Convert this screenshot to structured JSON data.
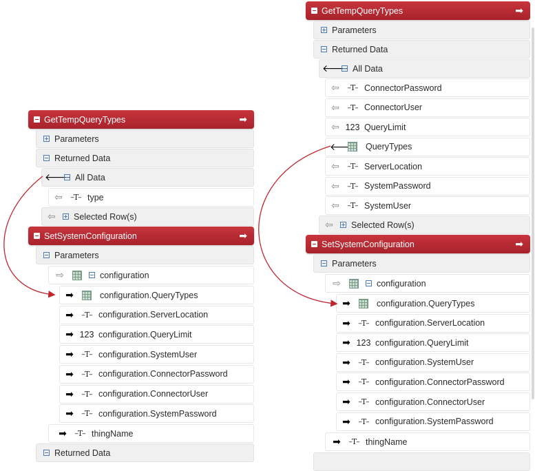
{
  "left": {
    "src": {
      "title": "GetTempQueryTypes",
      "parameters": "Parameters",
      "returned_data": "Returned Data",
      "all_data": "All Data",
      "fields": [
        {
          "kind": "T",
          "name": "type"
        }
      ],
      "selected_rows": "Selected Row(s)"
    },
    "dst": {
      "title": "SetSystemConfiguration",
      "parameters": "Parameters",
      "configuration": "configuration",
      "fields": [
        {
          "kind": "G",
          "name": "configuration.QueryTypes"
        },
        {
          "kind": "T",
          "name": "configuration.ServerLocation"
        },
        {
          "kind": "N",
          "name": "configuration.QueryLimit"
        },
        {
          "kind": "T",
          "name": "configuration.SystemUser"
        },
        {
          "kind": "T",
          "name": "configuration.ConnectorPassword"
        },
        {
          "kind": "T",
          "name": "configuration.ConnectorUser"
        },
        {
          "kind": "T",
          "name": "configuration.SystemPassword"
        }
      ],
      "thing_name": "thingName",
      "returned_data": "Returned Data"
    }
  },
  "right": {
    "src": {
      "title": "GetTempQueryTypes",
      "parameters": "Parameters",
      "returned_data": "Returned Data",
      "all_data": "All Data",
      "fields": [
        {
          "kind": "T",
          "name": "ConnectorPassword"
        },
        {
          "kind": "T",
          "name": "ConnectorUser"
        },
        {
          "kind": "N",
          "name": "QueryLimit"
        },
        {
          "kind": "G",
          "name": "QueryTypes"
        },
        {
          "kind": "T",
          "name": "ServerLocation"
        },
        {
          "kind": "T",
          "name": "SystemPassword"
        },
        {
          "kind": "T",
          "name": "SystemUser"
        }
      ],
      "selected_rows": "Selected Row(s)"
    },
    "dst": {
      "title": "SetSystemConfiguration",
      "parameters": "Parameters",
      "configuration": "configuration",
      "fields": [
        {
          "kind": "G",
          "name": "configuration.QueryTypes"
        },
        {
          "kind": "T",
          "name": "configuration.ServerLocation"
        },
        {
          "kind": "N",
          "name": "configuration.QueryLimit"
        },
        {
          "kind": "T",
          "name": "configuration.SystemUser"
        },
        {
          "kind": "T",
          "name": "configuration.ConnectorPassword"
        },
        {
          "kind": "T",
          "name": "configuration.ConnectorUser"
        },
        {
          "kind": "T",
          "name": "configuration.SystemPassword"
        }
      ],
      "thing_name": "thingName"
    }
  },
  "type_glyphs": {
    "T": "–T–",
    "N": "123"
  },
  "colors": {
    "header_red": "#b52a32",
    "connector_red": "#c0272d"
  },
  "icons": {
    "collapse": "minus-box-icon",
    "expand": "plus-box-icon",
    "mapped": "black-left-arrow-icon",
    "unmapped": "outline-left-arrow-icon",
    "target": "black-right-arrow-icon",
    "infotable": "infotable-grid-icon",
    "header_action": "white-right-arrow-icon"
  }
}
